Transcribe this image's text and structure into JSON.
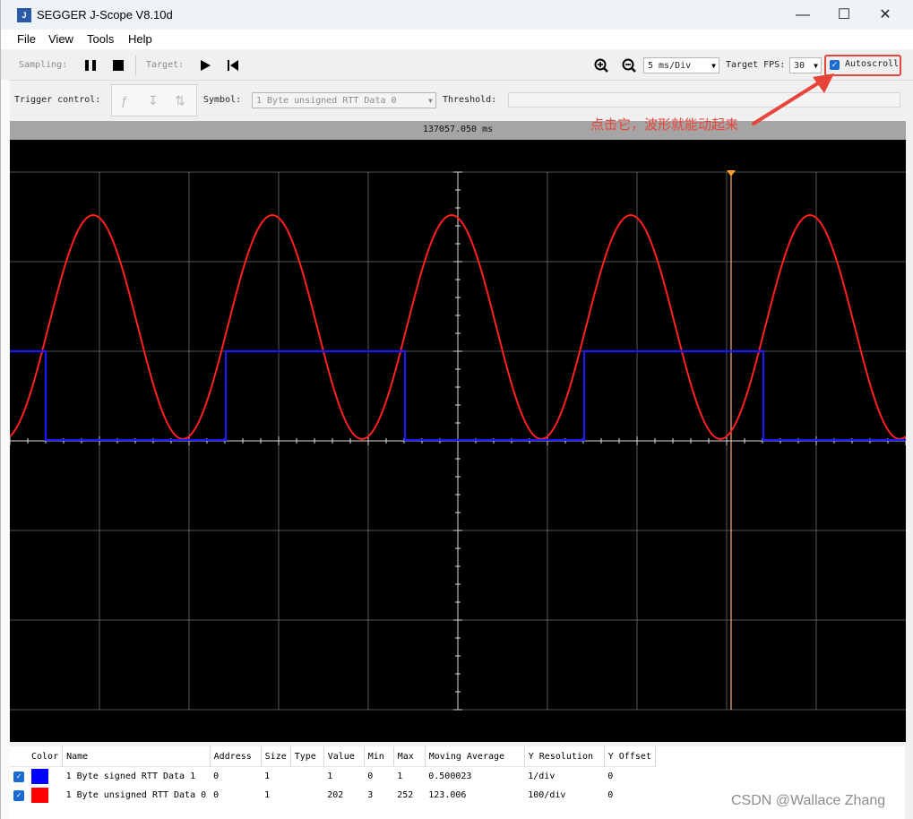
{
  "window": {
    "title": "SEGGER J-Scope V8.10d",
    "icon_name": "jscope-app-icon",
    "controls": [
      "minimize-icon",
      "maximize-icon",
      "close-icon"
    ]
  },
  "menu": [
    "File",
    "View",
    "Tools",
    "Help"
  ],
  "toolbar": {
    "sampling_label": "Sampling:",
    "target_label": "Target:",
    "timebase": "5 ms/Div",
    "fps_label": "Target FPS:",
    "fps_value": "30",
    "autoscroll_label": "Autoscroll",
    "autoscroll_checked": true
  },
  "trigger": {
    "label": "Trigger control:",
    "symbol_label": "Symbol:",
    "symbol_value": "1 Byte unsigned RTT Data 0",
    "threshold_label": "Threshold:",
    "threshold_value": ""
  },
  "time_readout": "137057.050 ms",
  "annotation": "点击它，波形就能动起来",
  "watermark": "CSDN @Wallace Zhang",
  "table": {
    "headers": [
      "Color",
      "Name",
      "Address",
      "Size",
      "Type",
      "Value",
      "Min",
      "Max",
      "Moving Average",
      "Y Resolution",
      "Y Offset"
    ],
    "rows": [
      {
        "checked": true,
        "color": "#0000ff",
        "name": "1 Byte signed RTT Data 1",
        "address": "0",
        "size": "1",
        "type": "",
        "value": "1",
        "min": "0",
        "max": "1",
        "avg": "0.500023",
        "yres": "1/div",
        "yoff": "0"
      },
      {
        "checked": true,
        "color": "#ff0000",
        "name": "1 Byte unsigned RTT Data 0",
        "address": "0",
        "size": "1",
        "type": "",
        "value": "202",
        "min": "3",
        "max": "252",
        "avg": "123.006",
        "yres": "100/div",
        "yoff": "0"
      }
    ]
  },
  "colors": {
    "scope_bg": "#000000",
    "grid": "#6e6e6e",
    "sine": "#ff2020",
    "square": "#1a1aff",
    "cursor": "#ffb070",
    "annotation": "#e8453a"
  }
}
